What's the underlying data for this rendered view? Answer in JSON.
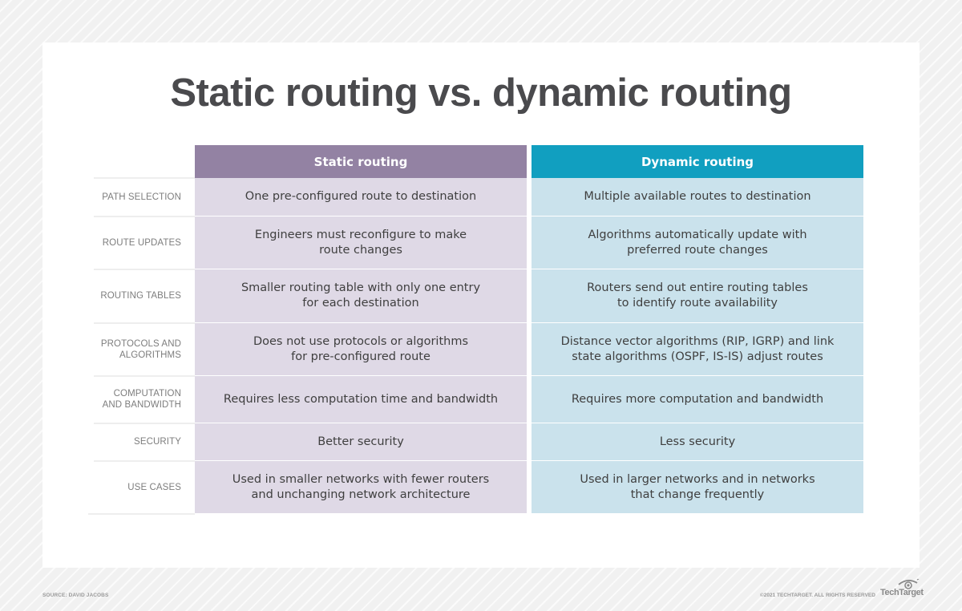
{
  "title": "Static routing vs. dynamic routing",
  "colors": {
    "static_header": "#9382a3",
    "static_cell": "#dfd9e6",
    "dynamic_header": "#119fc0",
    "dynamic_cell": "#cae2ec"
  },
  "columns": {
    "static": "Static routing",
    "dynamic": "Dynamic routing"
  },
  "rows": [
    {
      "label": "PATH SELECTION",
      "static": "One pre-configured route to destination",
      "dynamic": "Multiple available routes to destination"
    },
    {
      "label": "ROUTE UPDATES",
      "static": "Engineers must reconfigure to make\nroute changes",
      "dynamic": "Algorithms automatically update with\npreferred route changes"
    },
    {
      "label": "ROUTING TABLES",
      "static": "Smaller routing table with only one entry\nfor each destination",
      "dynamic": "Routers send out entire routing tables\nto identify route availability"
    },
    {
      "label": "PROTOCOLS AND\nALGORITHMS",
      "static": "Does not use protocols or algorithms\nfor pre-configured route",
      "dynamic": "Distance vector algorithms (RIP, IGRP) and link\nstate algorithms (OSPF, IS-IS) adjust routes"
    },
    {
      "label": "COMPUTATION\nAND BANDWIDTH",
      "static": "Requires less computation time and bandwidth",
      "dynamic": "Requires more computation and bandwidth"
    },
    {
      "label": "SECURITY",
      "static": "Better security",
      "dynamic": "Less security"
    },
    {
      "label": "USE CASES",
      "static": "Used in smaller networks with fewer routers\nand unchanging network architecture",
      "dynamic": "Used in larger networks and in networks\nthat change frequently"
    }
  ],
  "footer": {
    "source": "SOURCE: DAVID JACOBS",
    "copyright": "©2021 TECHTARGET. ALL RIGHTS RESERVED",
    "brand": "TechTarget",
    "brand_icon": "eye-icon"
  }
}
